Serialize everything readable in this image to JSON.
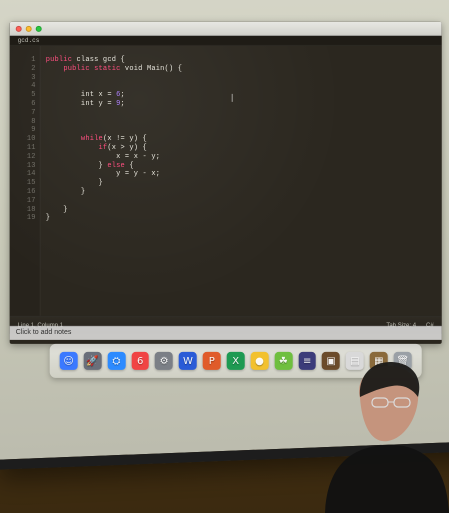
{
  "editor": {
    "tab_title": "gcd.cs",
    "code_lines": [
      {
        "n": "1",
        "seg": [
          {
            "cls": "kw",
            "text": "public"
          },
          {
            "cls": "t",
            "text": " class gcd {"
          }
        ]
      },
      {
        "n": "2",
        "seg": [
          {
            "cls": "t",
            "text": "    "
          },
          {
            "cls": "kw",
            "text": "public static"
          },
          {
            "cls": "t",
            "text": " void Main() {"
          }
        ]
      },
      {
        "n": "3",
        "seg": [
          {
            "cls": "t",
            "text": ""
          }
        ]
      },
      {
        "n": "4",
        "seg": [
          {
            "cls": "t",
            "text": ""
          }
        ]
      },
      {
        "n": "5",
        "seg": [
          {
            "cls": "t",
            "text": "        int x = "
          },
          {
            "cls": "num",
            "text": "6"
          },
          {
            "cls": "t",
            "text": ";"
          }
        ]
      },
      {
        "n": "6",
        "seg": [
          {
            "cls": "t",
            "text": "        int y = "
          },
          {
            "cls": "num",
            "text": "9"
          },
          {
            "cls": "t",
            "text": ";"
          }
        ]
      },
      {
        "n": "7",
        "seg": [
          {
            "cls": "t",
            "text": ""
          }
        ]
      },
      {
        "n": "8",
        "seg": [
          {
            "cls": "t",
            "text": ""
          }
        ]
      },
      {
        "n": "9",
        "seg": [
          {
            "cls": "t",
            "text": ""
          }
        ]
      },
      {
        "n": "10",
        "seg": [
          {
            "cls": "t",
            "text": "        "
          },
          {
            "cls": "kw",
            "text": "while"
          },
          {
            "cls": "t",
            "text": "(x != y) {"
          }
        ]
      },
      {
        "n": "11",
        "seg": [
          {
            "cls": "t",
            "text": "            "
          },
          {
            "cls": "kw",
            "text": "if"
          },
          {
            "cls": "t",
            "text": "(x > y) {"
          }
        ]
      },
      {
        "n": "12",
        "seg": [
          {
            "cls": "t",
            "text": "                x = x - y;"
          }
        ]
      },
      {
        "n": "13",
        "seg": [
          {
            "cls": "t",
            "text": "            } "
          },
          {
            "cls": "kw",
            "text": "else"
          },
          {
            "cls": "t",
            "text": " {"
          }
        ]
      },
      {
        "n": "14",
        "seg": [
          {
            "cls": "t",
            "text": "                y = y - x;"
          }
        ]
      },
      {
        "n": "15",
        "seg": [
          {
            "cls": "t",
            "text": "            }"
          }
        ]
      },
      {
        "n": "16",
        "seg": [
          {
            "cls": "t",
            "text": "        }"
          }
        ]
      },
      {
        "n": "17",
        "seg": [
          {
            "cls": "t",
            "text": ""
          }
        ]
      },
      {
        "n": "18",
        "seg": [
          {
            "cls": "t",
            "text": "    }"
          }
        ]
      },
      {
        "n": "19",
        "seg": [
          {
            "cls": "t",
            "text": "}"
          }
        ]
      }
    ],
    "status_left": "Line 1, Column 1",
    "status_right": [
      "Tab Size: 4",
      "C#"
    ]
  },
  "slides": {
    "notes_placeholder": "Click to add notes"
  },
  "dock": {
    "icons": [
      {
        "name": "finder-icon",
        "glyph": "☺",
        "bg": "#3b79ff"
      },
      {
        "name": "launchpad-icon",
        "glyph": "🚀",
        "bg": "#6a6f7a"
      },
      {
        "name": "safari-icon",
        "glyph": "⛭",
        "bg": "#2d8bff"
      },
      {
        "name": "calendar-icon",
        "glyph": "6",
        "bg": "#f04444"
      },
      {
        "name": "system-preferences-icon",
        "glyph": "⚙",
        "bg": "#7b7f86"
      },
      {
        "name": "word-icon",
        "glyph": "W",
        "bg": "#2a5bd7"
      },
      {
        "name": "powerpoint-icon",
        "glyph": "P",
        "bg": "#e05b2a"
      },
      {
        "name": "excel-icon",
        "glyph": "X",
        "bg": "#1e9a52"
      },
      {
        "name": "chrome-icon",
        "glyph": "●",
        "bg": "#f2c12e"
      },
      {
        "name": "android-icon",
        "glyph": "☘",
        "bg": "#6fbf3f"
      },
      {
        "name": "stripes-app-icon",
        "glyph": "≡",
        "bg": "#3c3c7a"
      },
      {
        "name": "photos-app-icon",
        "glyph": "▣",
        "bg": "#6b4b2a"
      },
      {
        "name": "document-icon",
        "glyph": "▤",
        "bg": "#d9d9d9"
      },
      {
        "name": "preview-icon",
        "glyph": "▦",
        "bg": "#8a6a3b"
      },
      {
        "name": "trash-icon",
        "glyph": "🗑",
        "bg": "#9aa0a6"
      }
    ]
  }
}
